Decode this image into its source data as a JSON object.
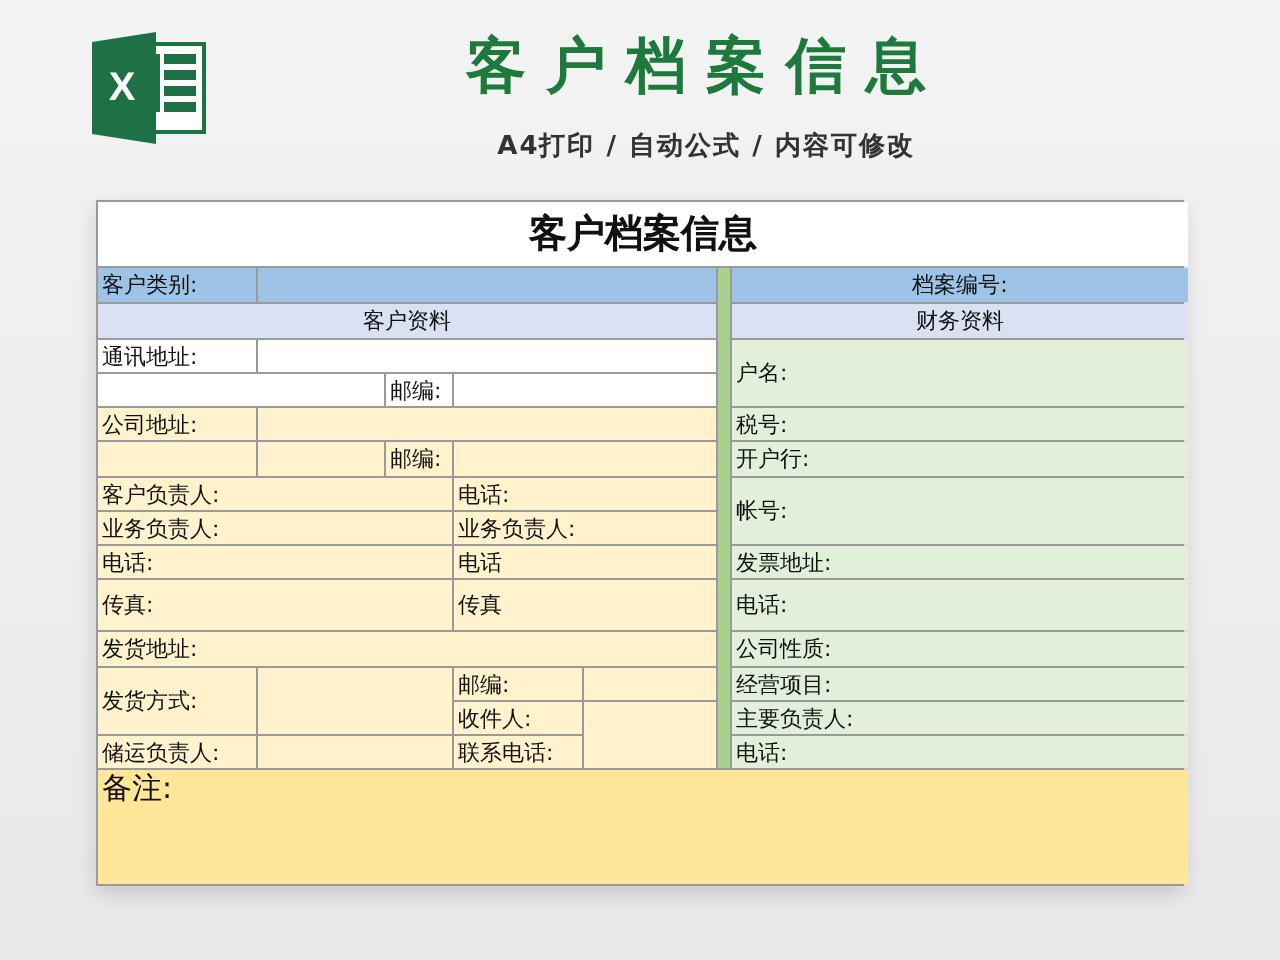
{
  "logo_letter": "X",
  "heading": "客户档案信息",
  "subtitle": "A4打印 / 自动公式 / 内容可修改",
  "sheet": {
    "title": "客户档案信息",
    "category_label": "客户类别:",
    "file_no_label": "档案编号:",
    "customer_section": {
      "title": "客户资料",
      "fields": [
        "通讯地址:",
        "邮编:",
        "公司地址:",
        "邮编:",
        "客户负责人:",
        "电话:",
        "业务负责人:",
        "业务负责人:",
        "电话:",
        "电话",
        "传真:",
        "传真",
        "发货地址:",
        "发货方式:",
        "邮编:",
        "收件人:",
        "储运负责人:",
        "联系电话:"
      ]
    },
    "finance_section": {
      "title": "财务资料",
      "fields": [
        "户名:",
        "税号:",
        "开户行:",
        "帐号:",
        "发票地址:",
        "电话:",
        "公司性质:",
        "经营项目:",
        "主要负责人:",
        "电话:"
      ]
    },
    "remarks_label": "备注:"
  }
}
